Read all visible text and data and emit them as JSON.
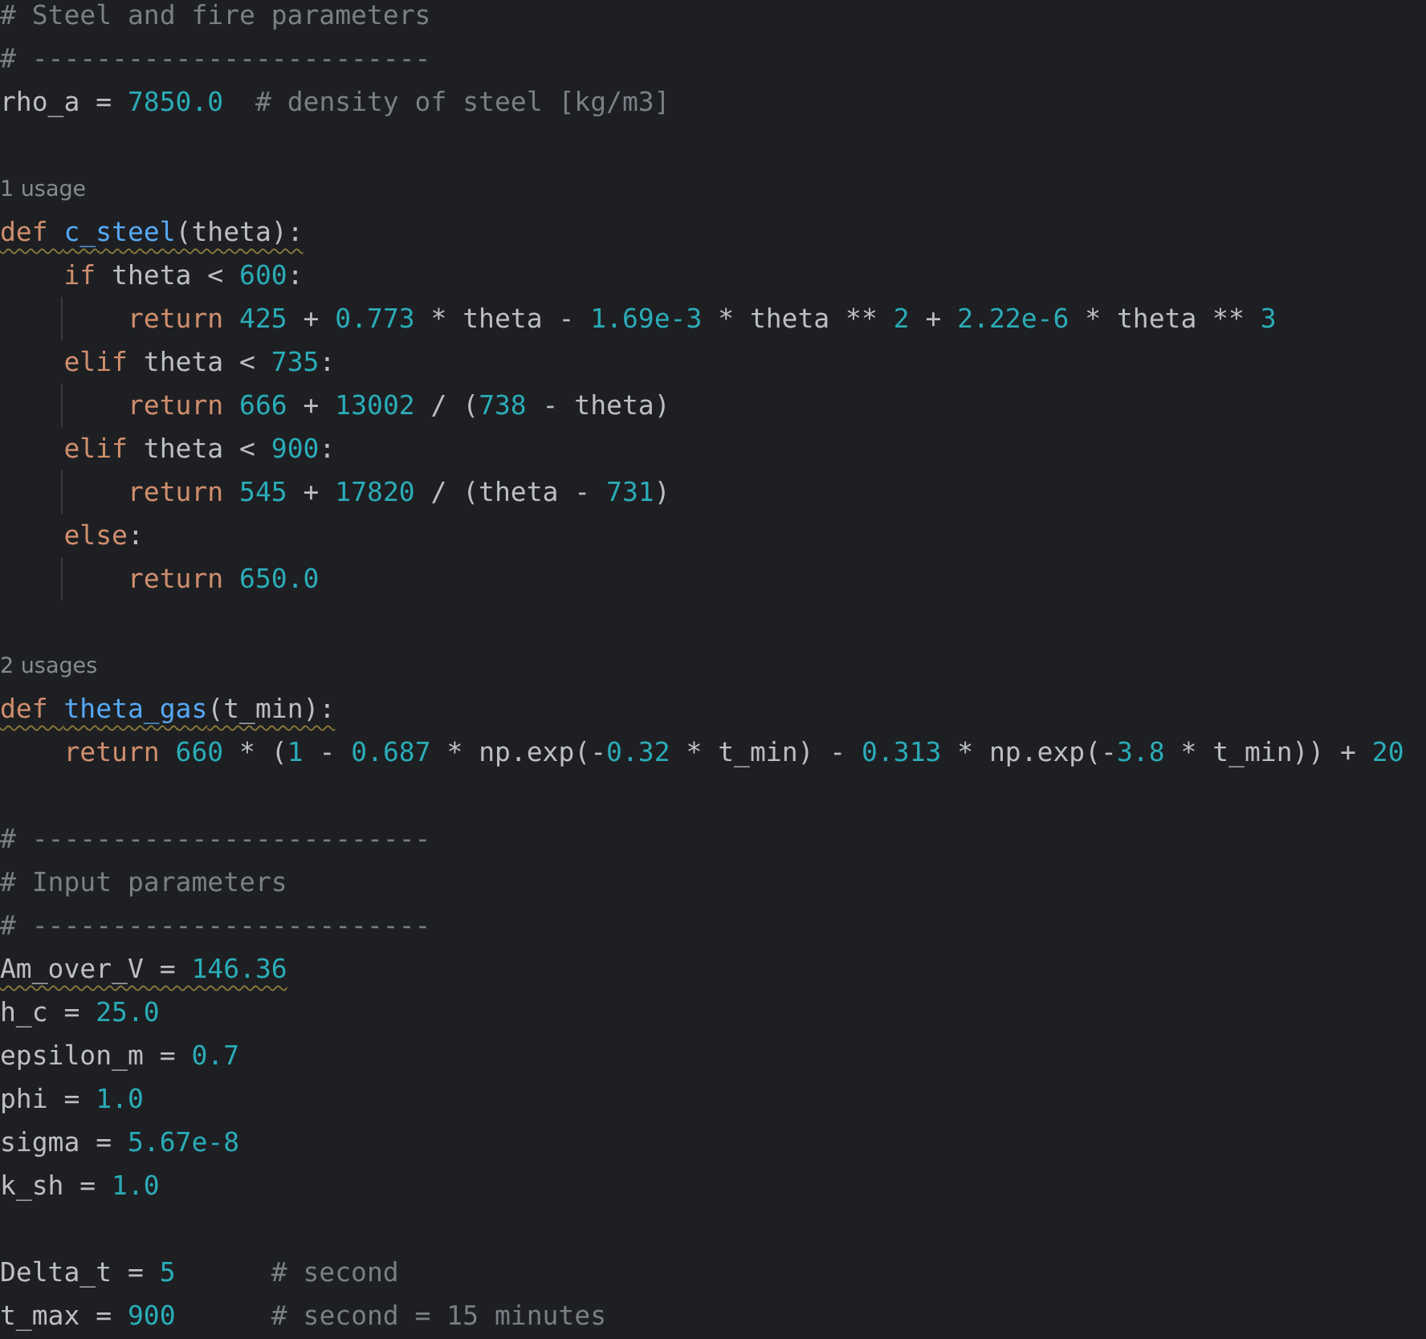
{
  "editor": {
    "lines": [
      {
        "kind": "code",
        "tokens": [
          {
            "kind": "comment",
            "text": "# Steel and fire parameters"
          }
        ]
      },
      {
        "kind": "code",
        "tokens": [
          {
            "kind": "comment",
            "text": "# -------------------------"
          }
        ]
      },
      {
        "kind": "code",
        "tokens": [
          {
            "kind": "plain",
            "text": "rho_a = "
          },
          {
            "kind": "number",
            "text": "7850.0"
          },
          {
            "kind": "comment",
            "text": "  # density of steel [kg/m3]"
          }
        ]
      },
      {
        "kind": "blank"
      },
      {
        "kind": "hint",
        "text": "1 usage"
      },
      {
        "kind": "code",
        "warning": true,
        "tokens": [
          {
            "kind": "keyword",
            "text": "def "
          },
          {
            "kind": "function",
            "text": "c_steel"
          },
          {
            "kind": "plain",
            "text": "(theta):"
          }
        ]
      },
      {
        "kind": "code",
        "tokens": [
          {
            "kind": "keyword",
            "text": "    if "
          },
          {
            "kind": "plain",
            "text": "theta < "
          },
          {
            "kind": "number",
            "text": "600"
          },
          {
            "kind": "plain",
            "text": ":"
          }
        ]
      },
      {
        "kind": "code",
        "guide": true,
        "tokens": [
          {
            "kind": "keyword",
            "text": "        return "
          },
          {
            "kind": "number",
            "text": "425"
          },
          {
            "kind": "plain",
            "text": " + "
          },
          {
            "kind": "number",
            "text": "0.773"
          },
          {
            "kind": "plain",
            "text": " * theta - "
          },
          {
            "kind": "number",
            "text": "1.69e-3"
          },
          {
            "kind": "plain",
            "text": " * theta ** "
          },
          {
            "kind": "number",
            "text": "2"
          },
          {
            "kind": "plain",
            "text": " + "
          },
          {
            "kind": "number",
            "text": "2.22e-6"
          },
          {
            "kind": "plain",
            "text": " * theta ** "
          },
          {
            "kind": "number",
            "text": "3"
          }
        ]
      },
      {
        "kind": "code",
        "tokens": [
          {
            "kind": "keyword",
            "text": "    elif "
          },
          {
            "kind": "plain",
            "text": "theta < "
          },
          {
            "kind": "number",
            "text": "735"
          },
          {
            "kind": "plain",
            "text": ":"
          }
        ]
      },
      {
        "kind": "code",
        "guide": true,
        "tokens": [
          {
            "kind": "keyword",
            "text": "        return "
          },
          {
            "kind": "number",
            "text": "666"
          },
          {
            "kind": "plain",
            "text": " + "
          },
          {
            "kind": "number",
            "text": "13002"
          },
          {
            "kind": "plain",
            "text": " / ("
          },
          {
            "kind": "number",
            "text": "738"
          },
          {
            "kind": "plain",
            "text": " - theta)"
          }
        ]
      },
      {
        "kind": "code",
        "tokens": [
          {
            "kind": "keyword",
            "text": "    elif "
          },
          {
            "kind": "plain",
            "text": "theta < "
          },
          {
            "kind": "number",
            "text": "900"
          },
          {
            "kind": "plain",
            "text": ":"
          }
        ]
      },
      {
        "kind": "code",
        "guide": true,
        "tokens": [
          {
            "kind": "keyword",
            "text": "        return "
          },
          {
            "kind": "number",
            "text": "545"
          },
          {
            "kind": "plain",
            "text": " + "
          },
          {
            "kind": "number",
            "text": "17820"
          },
          {
            "kind": "plain",
            "text": " / (theta - "
          },
          {
            "kind": "number",
            "text": "731"
          },
          {
            "kind": "plain",
            "text": ")"
          }
        ]
      },
      {
        "kind": "code",
        "tokens": [
          {
            "kind": "keyword",
            "text": "    else"
          },
          {
            "kind": "plain",
            "text": ":"
          }
        ]
      },
      {
        "kind": "code",
        "guide": true,
        "tokens": [
          {
            "kind": "keyword",
            "text": "        return "
          },
          {
            "kind": "number",
            "text": "650.0"
          }
        ]
      },
      {
        "kind": "blank"
      },
      {
        "kind": "hint",
        "text": "2 usages"
      },
      {
        "kind": "code",
        "warning": true,
        "tokens": [
          {
            "kind": "keyword",
            "text": "def "
          },
          {
            "kind": "function",
            "text": "theta_gas"
          },
          {
            "kind": "plain",
            "text": "(t_min):"
          }
        ]
      },
      {
        "kind": "code",
        "tokens": [
          {
            "kind": "keyword",
            "text": "    return "
          },
          {
            "kind": "number",
            "text": "660"
          },
          {
            "kind": "plain",
            "text": " * ("
          },
          {
            "kind": "number",
            "text": "1"
          },
          {
            "kind": "plain",
            "text": " - "
          },
          {
            "kind": "number",
            "text": "0.687"
          },
          {
            "kind": "plain",
            "text": " * np.exp(-"
          },
          {
            "kind": "number",
            "text": "0.32"
          },
          {
            "kind": "plain",
            "text": " * t_min) - "
          },
          {
            "kind": "number",
            "text": "0.313"
          },
          {
            "kind": "plain",
            "text": " * np.exp(-"
          },
          {
            "kind": "number",
            "text": "3.8"
          },
          {
            "kind": "plain",
            "text": " * t_min)) + "
          },
          {
            "kind": "number",
            "text": "20"
          }
        ]
      },
      {
        "kind": "blank"
      },
      {
        "kind": "code",
        "tokens": [
          {
            "kind": "comment",
            "text": "# -------------------------"
          }
        ]
      },
      {
        "kind": "code",
        "tokens": [
          {
            "kind": "comment",
            "text": "# Input parameters"
          }
        ]
      },
      {
        "kind": "code",
        "tokens": [
          {
            "kind": "comment",
            "text": "# -------------------------"
          }
        ]
      },
      {
        "kind": "code",
        "warning": true,
        "tokens": [
          {
            "kind": "plain",
            "text": "Am_over_V = "
          },
          {
            "kind": "number",
            "text": "146.36"
          }
        ]
      },
      {
        "kind": "code",
        "tokens": [
          {
            "kind": "plain",
            "text": "h_c = "
          },
          {
            "kind": "number",
            "text": "25.0"
          }
        ]
      },
      {
        "kind": "code",
        "tokens": [
          {
            "kind": "plain",
            "text": "epsilon_m = "
          },
          {
            "kind": "number",
            "text": "0.7"
          }
        ]
      },
      {
        "kind": "code",
        "tokens": [
          {
            "kind": "plain",
            "text": "phi = "
          },
          {
            "kind": "number",
            "text": "1.0"
          }
        ]
      },
      {
        "kind": "code",
        "tokens": [
          {
            "kind": "plain",
            "text": "sigma = "
          },
          {
            "kind": "number",
            "text": "5.67e-8"
          }
        ]
      },
      {
        "kind": "code",
        "tokens": [
          {
            "kind": "plain",
            "text": "k_sh = "
          },
          {
            "kind": "number",
            "text": "1.0"
          }
        ]
      },
      {
        "kind": "blank"
      },
      {
        "kind": "code",
        "tokens": [
          {
            "kind": "plain",
            "text": "Delta_t = "
          },
          {
            "kind": "number",
            "text": "5"
          },
          {
            "kind": "comment",
            "text": "      # second"
          }
        ]
      },
      {
        "kind": "code",
        "tokens": [
          {
            "kind": "plain",
            "text": "t_max = "
          },
          {
            "kind": "number",
            "text": "900"
          },
          {
            "kind": "comment",
            "text": "      # second = 15 minutes"
          }
        ]
      }
    ]
  }
}
